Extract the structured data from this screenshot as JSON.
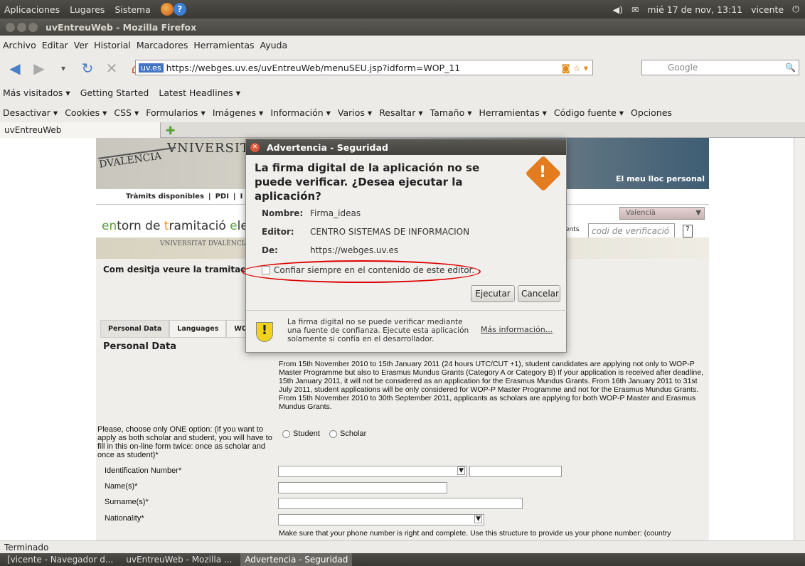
{
  "gnome_top": {
    "menus": [
      "Aplicaciones",
      "Lugares",
      "Sistema"
    ],
    "clock": "mié 17 de nov, 13:11",
    "user": "vicente"
  },
  "window_title": "uvEntreuWeb - Mozilla Firefox",
  "menubar": [
    "Archivo",
    "Editar",
    "Ver",
    "Historial",
    "Marcadores",
    "Herramientas",
    "Ayuda"
  ],
  "url": {
    "badge": "uv.es",
    "value": "https://webges.uv.es/uvEntreuWeb/menuSEU.jsp?idform=WOP_11"
  },
  "search": {
    "placeholder": "Google"
  },
  "bookmarks": [
    "Más visitados ▾",
    "Getting Started",
    "Latest Headlines ▾"
  ],
  "devbar": [
    "Desactivar ▾",
    "Cookies ▾",
    "CSS ▾",
    "Formularios ▾",
    "Imágenes ▾",
    "Información ▾",
    "Varios ▾",
    "Resaltar ▾",
    "Tamaño ▾",
    "Herramientas ▾",
    "Código fuente ▾",
    "Opciones"
  ],
  "tab": {
    "label": "uvEntreuWeb"
  },
  "page": {
    "univ": "VNIVERSITAT",
    "valencia_seal": "DVALÈNCIA",
    "lloc": "El meu lloc personal",
    "tramits": [
      "Tràmits disponibles",
      "PDI",
      "I"
    ],
    "entorn": {
      "p1": "en",
      "p2": "torn de ",
      "p3": "t",
      "p4": "ramitació ",
      "p5": "e",
      "p6": "lectr"
    },
    "valencia": "Valencià",
    "codi_lbl": "ents",
    "codi": "codi de verificació",
    "band2": "VNIVERSITAT DVALÈNCIA",
    "question": "Com desitja veure la tramitació?",
    "tabs": [
      "Personal Data",
      "Languages",
      "WOP-"
    ],
    "pd_title": "Personal Data",
    "pd_text": "From 15th November 2010 to 15th January 2011 (24 hours UTC/CUT +1), student candidates are applying not only to WOP-P Master Programme but also to Erasmus Mundus Grants (Category A or Category B) If your application is received after deadline, 15th January 2011, it will not be considered as an application for the Erasmus Mundus Grants. From 16th January 2011 to 31st July 2011, student applications will be only considered for WOP-P Master Programme and not for the Erasmus Mundus Grants. From 15th November 2010 to 30th September 2011, applicants as scholars are applying for both WOP-P Master and Erasmus Mundus Grants.",
    "choose": "Please, choose only ONE option: (if you want to apply as both scholar and student, you will have to fill in this on-line form twice: once as scholar and once as student)*",
    "radio_student": "Student",
    "radio_scholar": "Scholar",
    "id_number": "Identification Number*",
    "names": "Name(s)*",
    "surnames": "Surname(s)*",
    "nationality": "Nationality*",
    "phone_note": "Make sure that your phone number is right and complete. Use this structure to provide us your phone number: (country"
  },
  "dialog": {
    "title": "Advertencia - Seguridad",
    "warning": "La firma digital de la aplicación no se puede verificar. ¿Desea ejecutar la aplicación?",
    "nombre_lbl": "Nombre:",
    "nombre": "Firma_ideas",
    "editor_lbl": "Editor:",
    "editor": "CENTRO SISTEMAS DE INFORMACION",
    "de_lbl": "De:",
    "de": "https://webges.uv.es",
    "trust": "Confiar siempre en el contenido de este editor.",
    "run": "Ejecutar",
    "cancel": "Cancelar",
    "note": "La firma digital no se puede verificar mediante una fuente de confianza. Ejecute esta aplicación solamente si confía en el desarrollador.",
    "more": "Más información..."
  },
  "status": "Terminado",
  "taskbar": [
    "[vicente - Navegador d...",
    "uvEntreuWeb - Mozilla ...",
    "Advertencia - Seguridad"
  ]
}
